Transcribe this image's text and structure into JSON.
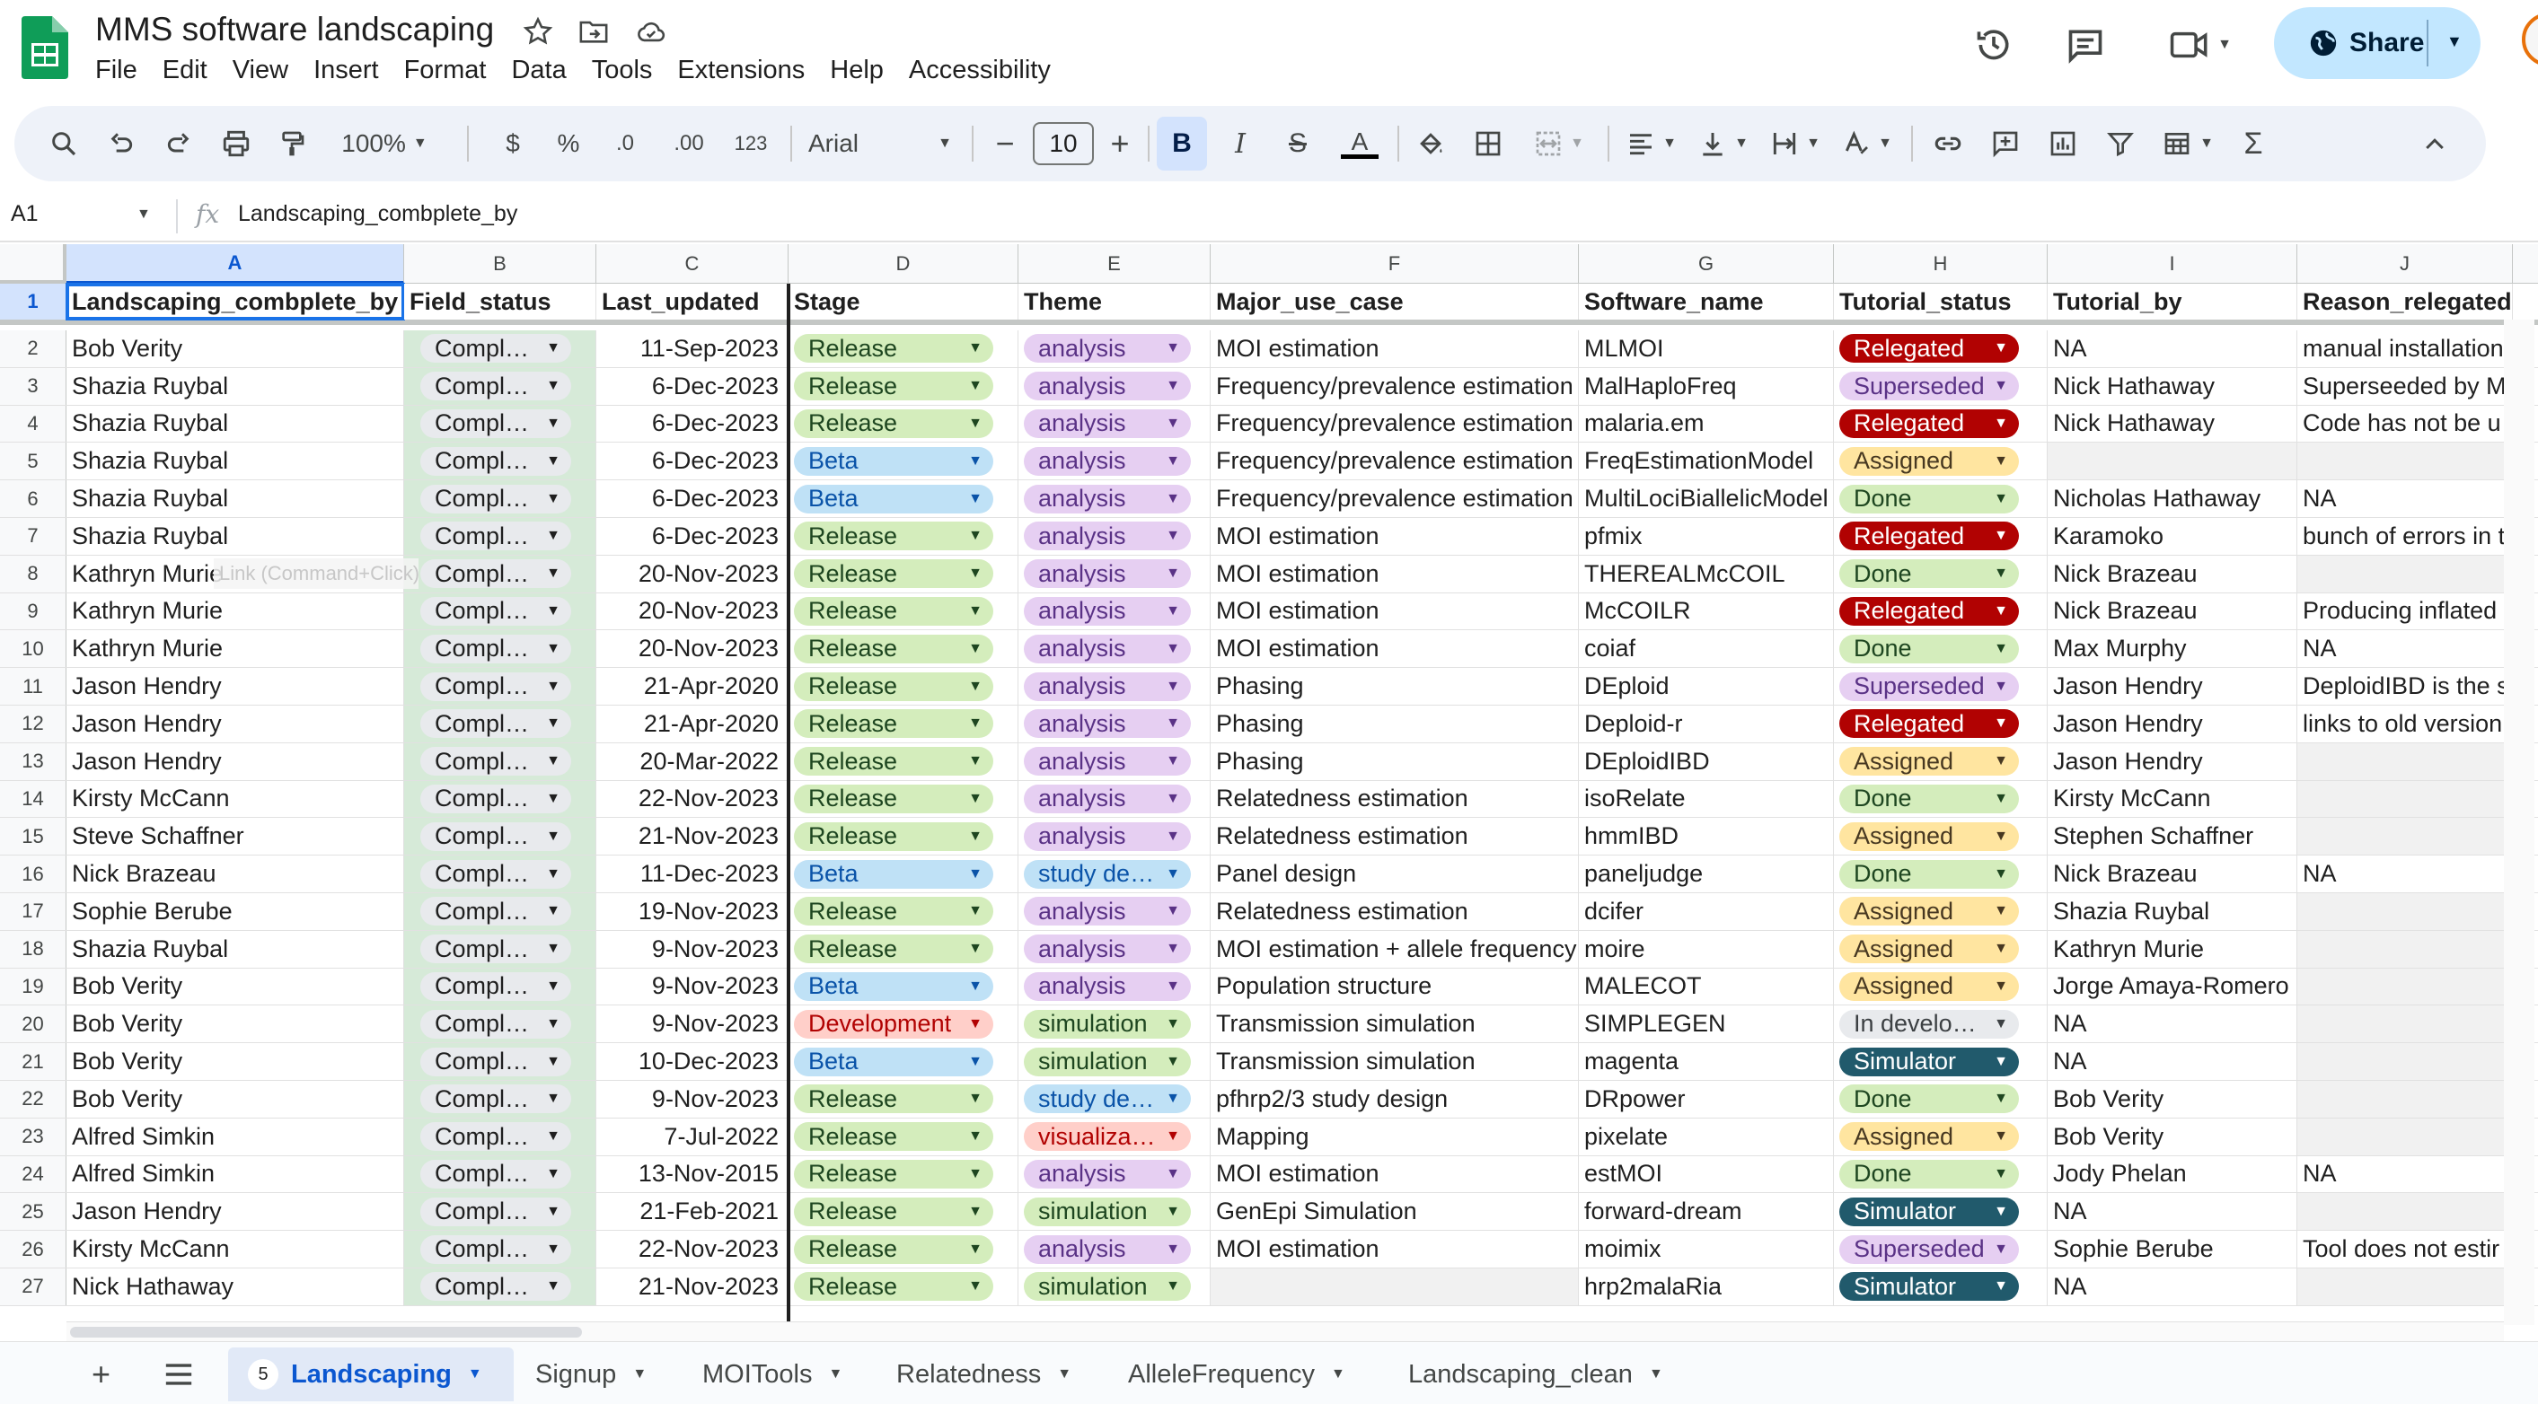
{
  "app": {
    "title": "MMS software landscaping",
    "menu": [
      "File",
      "Edit",
      "View",
      "Insert",
      "Format",
      "Data",
      "Tools",
      "Extensions",
      "Help",
      "Accessibility"
    ],
    "share_label": "Share"
  },
  "toolbar": {
    "zoom": "100%",
    "currency": "$",
    "percent": "%",
    "dec_decrease": ".0",
    "dec_increase": ".00",
    "number_format": "123",
    "font": "Arial",
    "font_size": "10"
  },
  "formula_bar": {
    "cell_ref": "A1",
    "fx": "fx",
    "value": "Landscaping_combplete_by"
  },
  "tooltip": "Link (Command+Click)",
  "colors": {
    "accent": "#0b57d0",
    "field_status_bg": "#d6ead8"
  },
  "sheet": {
    "column_letters": [
      "A",
      "B",
      "C",
      "D",
      "E",
      "F",
      "G",
      "H",
      "I",
      "J"
    ],
    "headers": [
      "Landscaping_combplete_by",
      "Field_status",
      "Last_updated",
      "Stage",
      "Theme",
      "Major_use_case",
      "Software_name",
      "Tutorial_status",
      "Tutorial_by",
      "Reason_relegated"
    ],
    "rows": [
      {
        "n": "2",
        "a": "Bob Verity",
        "b": "Complete",
        "c": "11-Sep-2023",
        "d": "Release",
        "e": "analysis",
        "f": "MOI estimation",
        "g": "MLMOI",
        "h": "Relegated",
        "i": "NA",
        "j": "manual installation"
      },
      {
        "n": "3",
        "a": "Shazia Ruybal",
        "b": "Complete",
        "c": "6-Dec-2023",
        "d": "Release",
        "e": "analysis",
        "f": "Frequency/prevalence estimation",
        "g": "MalHaploFreq",
        "h": "Superseded",
        "i": "Nick Hathaway",
        "j": "Superseeded by M"
      },
      {
        "n": "4",
        "a": "Shazia Ruybal",
        "b": "Complete",
        "c": "6-Dec-2023",
        "d": "Release",
        "e": "analysis",
        "f": "Frequency/prevalence estimation",
        "g": "malaria.em",
        "h": "Relegated",
        "i": "Nick Hathaway",
        "j": "Code has not be u"
      },
      {
        "n": "5",
        "a": "Shazia Ruybal",
        "b": "Complete",
        "c": "6-Dec-2023",
        "d": "Beta",
        "e": "analysis",
        "f": "Frequency/prevalence estimation",
        "g": "FreqEstimationModel",
        "h": "Assigned",
        "i": "",
        "j": ""
      },
      {
        "n": "6",
        "a": "Shazia Ruybal",
        "b": "Complete",
        "c": "6-Dec-2023",
        "d": "Beta",
        "e": "analysis",
        "f": "Frequency/prevalence estimation",
        "g": "MultiLociBiallelicModel",
        "h": "Done",
        "i": "Nicholas Hathaway",
        "j": "NA"
      },
      {
        "n": "7",
        "a": "Shazia Ruybal",
        "b": "Complete",
        "c": "6-Dec-2023",
        "d": "Release",
        "e": "analysis",
        "f": "MOI estimation",
        "g": "pfmix",
        "h": "Relegated",
        "i": "Karamoko",
        "j": "bunch of errors in t"
      },
      {
        "n": "8",
        "a": "Kathryn Murie",
        "b": "Complete",
        "c": "20-Nov-2023",
        "d": "Release",
        "e": "analysis",
        "f": "MOI estimation",
        "g": "THEREALMcCOIL",
        "h": "Done",
        "i": "Nick Brazeau",
        "j": ""
      },
      {
        "n": "9",
        "a": "Kathryn Murie",
        "b": "Complete",
        "c": "20-Nov-2023",
        "d": "Release",
        "e": "analysis",
        "f": "MOI estimation",
        "g": "McCOILR",
        "h": "Relegated",
        "i": "Nick Brazeau",
        "j": "Producing inflated"
      },
      {
        "n": "10",
        "a": "Kathryn Murie",
        "b": "Complete",
        "c": "20-Nov-2023",
        "d": "Release",
        "e": "analysis",
        "f": "MOI estimation",
        "g": "coiaf",
        "h": "Done",
        "i": "Max Murphy",
        "j": "NA"
      },
      {
        "n": "11",
        "a": "Jason Hendry",
        "b": "Complete",
        "c": "21-Apr-2020",
        "d": "Release",
        "e": "analysis",
        "f": "Phasing",
        "g": "DEploid",
        "h": "Superseded",
        "i": "Jason Hendry",
        "j": "DeploidIBD is the s"
      },
      {
        "n": "12",
        "a": "Jason Hendry",
        "b": "Complete",
        "c": "21-Apr-2020",
        "d": "Release",
        "e": "analysis",
        "f": "Phasing",
        "g": "Deploid-r",
        "h": "Relegated",
        "i": "Jason Hendry",
        "j": "links to old version"
      },
      {
        "n": "13",
        "a": "Jason Hendry",
        "b": "Complete",
        "c": "20-Mar-2022",
        "d": "Release",
        "e": "analysis",
        "f": "Phasing",
        "g": "DEploidIBD",
        "h": "Assigned",
        "i": "Jason Hendry",
        "j": ""
      },
      {
        "n": "14",
        "a": "Kirsty McCann",
        "b": "Complete",
        "c": "22-Nov-2023",
        "d": "Release",
        "e": "analysis",
        "f": "Relatedness estimation",
        "g": "isoRelate",
        "h": "Done",
        "i": "Kirsty McCann",
        "j": ""
      },
      {
        "n": "15",
        "a": "Steve Schaffner",
        "b": "Complete",
        "c": "21-Nov-2023",
        "d": "Release",
        "e": "analysis",
        "f": "Relatedness estimation",
        "g": "hmmIBD",
        "h": "Assigned",
        "i": "Stephen Schaffner",
        "j": ""
      },
      {
        "n": "16",
        "a": "Nick Brazeau",
        "b": "Complete",
        "c": "11-Dec-2023",
        "d": "Beta",
        "e": "study design",
        "f": "Panel design",
        "g": "paneljudge",
        "h": "Done",
        "i": "Nick Brazeau",
        "j": "NA"
      },
      {
        "n": "17",
        "a": "Sophie Berube",
        "b": "Complete",
        "c": "19-Nov-2023",
        "d": "Release",
        "e": "analysis",
        "f": "Relatedness estimation",
        "g": "dcifer",
        "h": "Assigned",
        "i": "Shazia Ruybal",
        "j": ""
      },
      {
        "n": "18",
        "a": "Shazia Ruybal",
        "b": "Complete",
        "c": "9-Nov-2023",
        "d": "Release",
        "e": "analysis",
        "f": "MOI estimation + allele frequency",
        "g": "moire",
        "h": "Assigned",
        "i": "Kathryn Murie",
        "j": ""
      },
      {
        "n": "19",
        "a": "Bob Verity",
        "b": "Complete",
        "c": "9-Nov-2023",
        "d": "Beta",
        "e": "analysis",
        "f": "Population structure",
        "g": "MALECOT",
        "h": "Assigned",
        "i": "Jorge Amaya-Romero",
        "j": ""
      },
      {
        "n": "20",
        "a": "Bob Verity",
        "b": "Complete",
        "c": "9-Nov-2023",
        "d": "Development",
        "e": "simulation",
        "f": "Transmission simulation",
        "g": "SIMPLEGEN",
        "h": "In development",
        "i": "NA",
        "j": ""
      },
      {
        "n": "21",
        "a": "Bob Verity",
        "b": "Complete",
        "c": "10-Dec-2023",
        "d": "Beta",
        "e": "simulation",
        "f": "Transmission simulation",
        "g": "magenta",
        "h": "Simulator",
        "i": "NA",
        "j": ""
      },
      {
        "n": "22",
        "a": "Bob Verity",
        "b": "Complete",
        "c": "9-Nov-2023",
        "d": "Release",
        "e": "study design",
        "f": "pfhrp2/3 study design",
        "g": "DRpower",
        "h": "Done",
        "i": "Bob Verity",
        "j": ""
      },
      {
        "n": "23",
        "a": "Alfred Simkin",
        "b": "Complete",
        "c": "7-Jul-2022",
        "d": "Release",
        "e": "visualization",
        "f": "Mapping",
        "g": "pixelate",
        "h": "Assigned",
        "i": "Bob Verity",
        "j": ""
      },
      {
        "n": "24",
        "a": "Alfred Simkin",
        "b": "Complete",
        "c": "13-Nov-2015",
        "d": "Release",
        "e": "analysis",
        "f": "MOI estimation",
        "g": "estMOI",
        "h": "Done",
        "i": "Jody Phelan",
        "j": "NA"
      },
      {
        "n": "25",
        "a": "Jason Hendry",
        "b": "Complete",
        "c": "21-Feb-2021",
        "d": "Release",
        "e": "simulation",
        "f": "GenEpi Simulation",
        "g": "forward-dream",
        "h": "Simulator",
        "i": "NA",
        "j": ""
      },
      {
        "n": "26",
        "a": "Kirsty McCann",
        "b": "Complete",
        "c": "22-Nov-2023",
        "d": "Release",
        "e": "analysis",
        "f": "MOI estimation",
        "g": "moimix",
        "h": "Superseded",
        "i": "Sophie Berube",
        "j": "Tool does not estir"
      },
      {
        "n": "27",
        "a": "Nick Hathaway",
        "b": "Complete",
        "c": "21-Nov-2023",
        "d": "Release",
        "e": "simulation",
        "f": "",
        "g": "hrp2malaRia",
        "h": "Simulator",
        "i": "NA",
        "j": ""
      }
    ]
  },
  "sheet_tabs": [
    {
      "label": "Landscaping",
      "badge": "5",
      "active": true
    },
    {
      "label": "Signup"
    },
    {
      "label": "MOITools"
    },
    {
      "label": "Relatedness"
    },
    {
      "label": "AlleleFrequency"
    },
    {
      "label": "Landscaping_clean"
    }
  ]
}
